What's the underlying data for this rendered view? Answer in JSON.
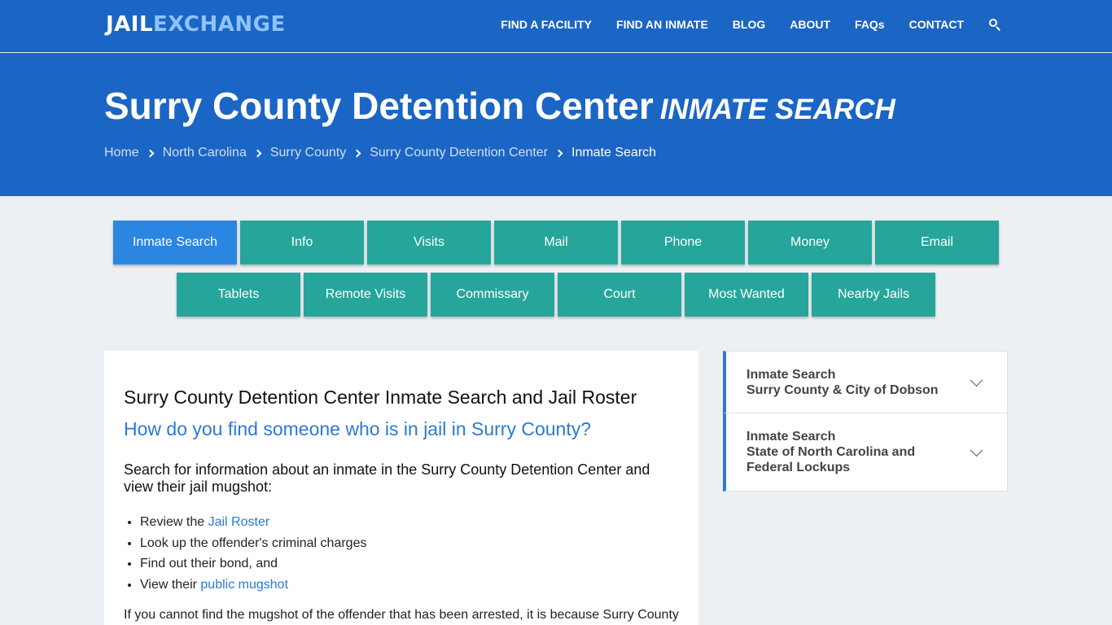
{
  "logo": {
    "part1": "JAIL",
    "part2": "EXCHANGE"
  },
  "nav": {
    "links": [
      "FIND A FACILITY",
      "FIND AN INMATE",
      "BLOG",
      "ABOUT",
      "FAQs",
      "CONTACT"
    ],
    "search_icon": "search-icon"
  },
  "hero": {
    "title": "Surry County Detention Center",
    "subtitle": "INMATE SEARCH",
    "breadcrumb": [
      "Home",
      "North Carolina",
      "Surry County",
      "Surry County Detention Center",
      "Inmate Search"
    ]
  },
  "tabs": {
    "row1": [
      "Inmate Search",
      "Info",
      "Visits",
      "Mail",
      "Phone",
      "Money",
      "Email"
    ],
    "row2": [
      "Tablets",
      "Remote Visits",
      "Commissary",
      "Court",
      "Most Wanted",
      "Nearby Jails"
    ],
    "active": "Inmate Search"
  },
  "main": {
    "heading": "Surry County Detention Center Inmate Search and Jail Roster",
    "question": "How do you find someone who is in jail in Surry County?",
    "lead": "Search for information about an inmate in the Surry County Detention Center and view their jail mugshot:",
    "bullets": [
      {
        "prefix": "Review the ",
        "link": "Jail Roster"
      },
      {
        "prefix": "Look up the offender's criminal charges",
        "link": ""
      },
      {
        "prefix": "Find out their bond, and",
        "link": ""
      },
      {
        "prefix": "View their ",
        "link": "public mugshot"
      }
    ],
    "para": "If you cannot find the mugshot of the offender that has been arrested, it is because Surry County"
  },
  "sidebar": {
    "items": [
      {
        "line1": "Inmate Search",
        "line2": "Surry County & City of Dobson"
      },
      {
        "line1": "Inmate Search",
        "line2": "State of North Carolina and Federal Lockups"
      }
    ]
  },
  "colors": {
    "primary": "#1b65c5",
    "teal": "#26a69a",
    "active_tab": "#2a86e0",
    "link": "#2a7ad6"
  }
}
